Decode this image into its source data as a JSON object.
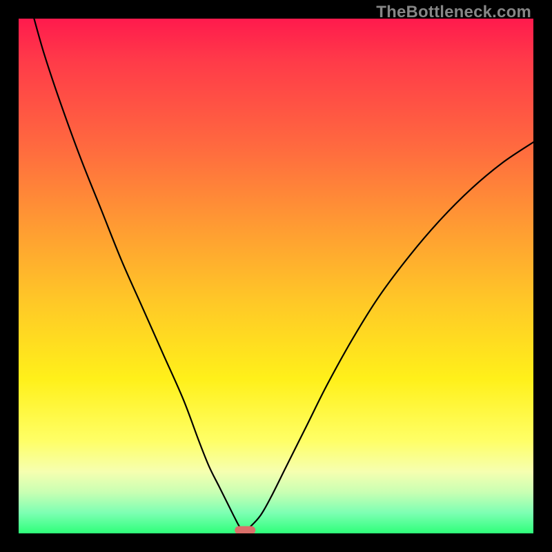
{
  "watermark": {
    "text": "TheBottleneck.com"
  },
  "chart_data": {
    "type": "line",
    "title": "",
    "xlabel": "",
    "ylabel": "",
    "xlim": [
      0,
      100
    ],
    "ylim": [
      0,
      100
    ],
    "grid": false,
    "series": [
      {
        "name": "bottleneck-curve",
        "x": [
          3,
          5,
          8,
          12,
          16,
          20,
          24,
          28,
          32,
          35,
          37,
          39,
          41,
          42,
          43,
          44,
          45,
          47,
          49,
          52,
          56,
          60,
          65,
          70,
          76,
          82,
          88,
          94,
          100
        ],
        "values": [
          100,
          93,
          84,
          73,
          63,
          53,
          44,
          35,
          26,
          18,
          13,
          9,
          5,
          3,
          1.2,
          0.7,
          1.3,
          3.5,
          7,
          13,
          21,
          29,
          38,
          46,
          54,
          61,
          67,
          72,
          76
        ]
      }
    ],
    "annotations": [
      {
        "name": "minimum-marker",
        "x": 44,
        "y": 0.6,
        "shape": "pill",
        "color": "#d9706a"
      }
    ],
    "background": {
      "type": "vertical-gradient",
      "stops": [
        {
          "pos": 0,
          "color": "#ff1a4d"
        },
        {
          "pos": 25,
          "color": "#ff6a3f"
        },
        {
          "pos": 55,
          "color": "#ffc827"
        },
        {
          "pos": 82,
          "color": "#ffff66"
        },
        {
          "pos": 100,
          "color": "#2eff7a"
        }
      ]
    }
  }
}
